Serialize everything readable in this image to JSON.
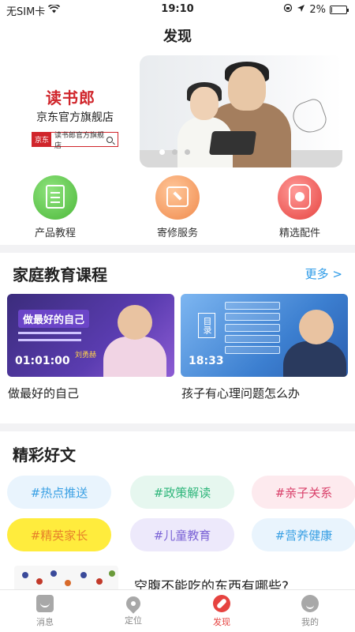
{
  "status_bar": {
    "carrier": "无SIM卡",
    "time": "19:10",
    "battery": "2%",
    "battery_level": 0.02
  },
  "header": {
    "title": "发现"
  },
  "banner": {
    "brand": "读书郎",
    "store_name": "京东官方旗舰店",
    "search_prefix": "京东",
    "search_text": "读书郎官方旗舰店",
    "slides": 3,
    "active_slide": 0
  },
  "quick_links": [
    {
      "label": "产品教程",
      "icon": "document-icon"
    },
    {
      "label": "寄修服务",
      "icon": "toolbox-icon"
    },
    {
      "label": "精选配件",
      "icon": "watch-icon"
    }
  ],
  "courses": {
    "title": "家庭教育课程",
    "more": "更多 >",
    "items": [
      {
        "thumb_title": "做最好的自己",
        "thumb_name": "刘勇赫",
        "duration": "01:01:00",
        "caption": "做最好的自己"
      },
      {
        "thumb_label": "目录",
        "duration": "18:33",
        "caption": "孩子有心理问题怎么办"
      }
    ]
  },
  "articles": {
    "title": "精彩好文",
    "tags": [
      "#热点推送",
      "#政策解读",
      "#亲子关系",
      "#精英家长",
      "#儿童教育",
      "#营养健康"
    ],
    "first_article": "空腹不能吃的东西有哪些?"
  },
  "tab_bar": [
    {
      "label": "消息",
      "icon": "message-icon",
      "active": false
    },
    {
      "label": "定位",
      "icon": "location-icon",
      "active": false
    },
    {
      "label": "发现",
      "icon": "compass-icon",
      "active": true
    },
    {
      "label": "我的",
      "icon": "profile-icon",
      "active": false
    }
  ]
}
